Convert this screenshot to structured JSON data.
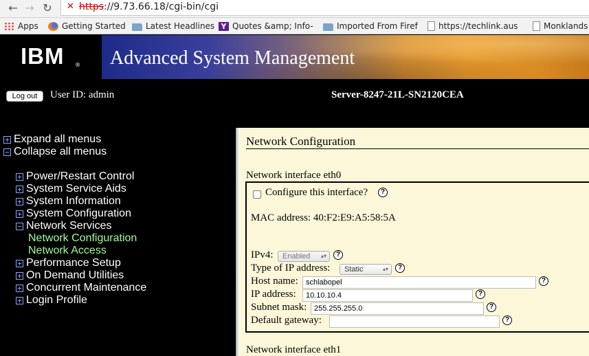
{
  "browser": {
    "url_scheme": "https",
    "url_rest": "://9.73.66.18/cgi-bin/cgi",
    "bookmarks": [
      {
        "label": "Apps",
        "icon": "apps-grid-icon"
      },
      {
        "label": "Getting Started",
        "icon": "firefox-icon"
      },
      {
        "label": "Latest Headlines",
        "icon": "folder-icon"
      },
      {
        "label": "Quotes &amp; Info-",
        "icon": "yahoo-icon"
      },
      {
        "label": "Imported From Firefo",
        "icon": "folder-icon"
      },
      {
        "label": "https://techlink.aus",
        "icon": "page-icon"
      },
      {
        "label": "Monklands I",
        "icon": "page-icon"
      }
    ]
  },
  "banner": {
    "logo_text": "IBM",
    "logo_mark": "®",
    "title": "Advanced System Management"
  },
  "session": {
    "logout_label": "Log out",
    "user_id": "User ID: admin",
    "server": "Server-8247-21L-SN2120CEA"
  },
  "nav": {
    "expand_all": "Expand all menus",
    "collapse_all": "Collapse all menus",
    "items": [
      {
        "label": "Power/Restart Control",
        "state": "+"
      },
      {
        "label": "System Service Aids",
        "state": "+"
      },
      {
        "label": "System Information",
        "state": "+"
      },
      {
        "label": "System Configuration",
        "state": "+"
      },
      {
        "label": "Network Services",
        "state": "−"
      },
      {
        "label": "Network Configuration",
        "state": ""
      },
      {
        "label": "Network Access",
        "state": ""
      },
      {
        "label": "Performance Setup",
        "state": "+"
      },
      {
        "label": "On Demand Utilities",
        "state": "+"
      },
      {
        "label": "Concurrent Maintenance",
        "state": "+"
      },
      {
        "label": "Login Profile",
        "state": "+"
      }
    ]
  },
  "content": {
    "title": "Network Configuration",
    "eth0": {
      "heading": "Network interface eth0",
      "configure_label": "Configure this interface?",
      "mac": "MAC address: 40:F2:E9:A5:58:5A",
      "ipv4_label": "IPv4:",
      "ipv4_value": "Enabled",
      "ip_type_label": "Type of IP address:",
      "ip_type_value": "Static",
      "host_label": "Host name:",
      "host_value": "schlabopel",
      "ip_label": "IP address:",
      "ip_value": "10.10.10.4",
      "subnet_label": "Subnet mask:",
      "subnet_value": "255.255.255.0",
      "gateway_label": "Default gateway:",
      "gateway_value": ""
    },
    "eth1": {
      "heading": "Network interface eth1"
    },
    "help_glyph": "?"
  },
  "colors": {
    "nav_bg": "#000000",
    "nav_selected": "#9dff9d",
    "content_bg": "#fdf7d9",
    "url_warning": "#cc0000"
  }
}
